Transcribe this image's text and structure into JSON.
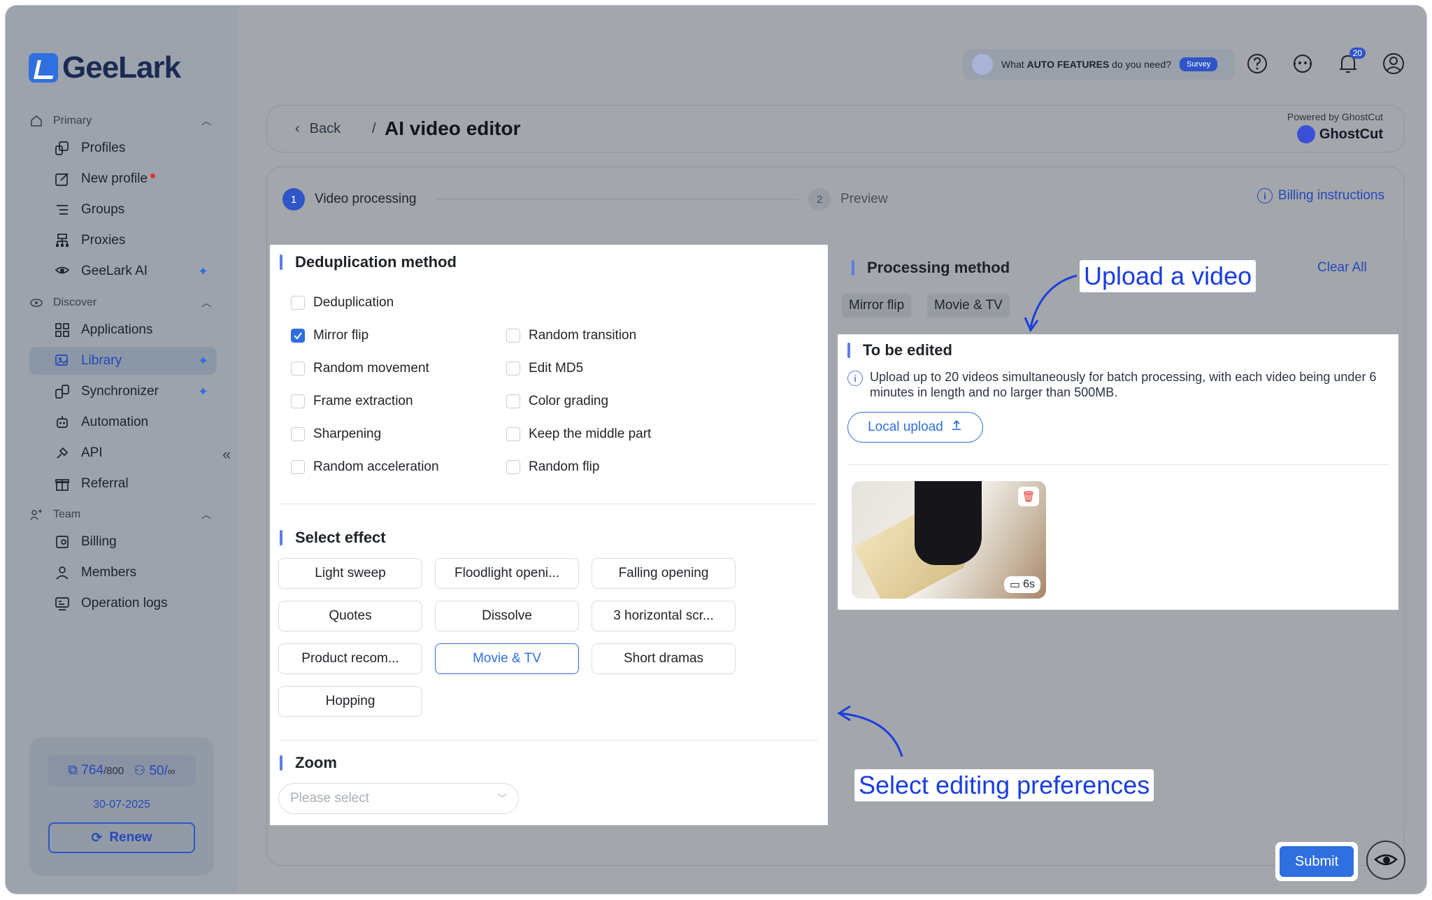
{
  "app": {
    "name": "GeeLark"
  },
  "sidebar": {
    "sections": [
      {
        "label": "Primary"
      },
      {
        "label": "Discover"
      },
      {
        "label": "Team"
      }
    ],
    "items": [
      {
        "label": "Profiles",
        "icon": "profiles-icon"
      },
      {
        "label": "New profile",
        "icon": "edit-icon"
      },
      {
        "label": "Groups",
        "icon": "list-icon"
      },
      {
        "label": "Proxies",
        "icon": "network-icon"
      },
      {
        "label": "GeeLark AI",
        "icon": "ai-eye-icon"
      },
      {
        "label": "Applications",
        "icon": "grid-icon"
      },
      {
        "label": "Library",
        "icon": "library-icon"
      },
      {
        "label": "Synchronizer",
        "icon": "sync-icon"
      },
      {
        "label": "Automation",
        "icon": "robot-icon"
      },
      {
        "label": "API",
        "icon": "api-icon"
      },
      {
        "label": "Referral",
        "icon": "gift-icon"
      },
      {
        "label": "Billing",
        "icon": "billing-icon"
      },
      {
        "label": "Members",
        "icon": "user-icon"
      },
      {
        "label": "Operation logs",
        "icon": "logs-icon"
      }
    ],
    "plan": {
      "profiles_used": "764",
      "profiles_total": "/800",
      "members_used": "50/",
      "members_total": "∞",
      "date": "30-07-2025",
      "renew_label": "Renew"
    }
  },
  "topbar": {
    "survey_prefix": "What ",
    "survey_bold": "AUTO FEATURES",
    "survey_suffix": " do you need?",
    "survey_button": "Survey",
    "notification_count": "20"
  },
  "header": {
    "back_label": "Back",
    "separator": "/",
    "title": "AI video editor",
    "powered_by": "Powered by GhostCut",
    "brand": "GhostCut"
  },
  "steps": [
    {
      "number": "1",
      "label": "Video processing"
    },
    {
      "number": "2",
      "label": "Preview"
    }
  ],
  "billing_instructions": "Billing instructions",
  "dedup": {
    "title": "Deduplication method",
    "options": [
      {
        "label": "Deduplication",
        "checked": false
      },
      {
        "label": "Mirror flip",
        "checked": true
      },
      {
        "label": "Random transition",
        "checked": false
      },
      {
        "label": "Random movement",
        "checked": false
      },
      {
        "label": "Edit MD5",
        "checked": false
      },
      {
        "label": "Frame extraction",
        "checked": false
      },
      {
        "label": "Color grading",
        "checked": false
      },
      {
        "label": "Sharpening",
        "checked": false
      },
      {
        "label": "Keep the middle part",
        "checked": false
      },
      {
        "label": "Random acceleration",
        "checked": false
      },
      {
        "label": "Random flip",
        "checked": false
      }
    ]
  },
  "effects": {
    "title": "Select effect",
    "items": [
      {
        "label": "Light sweep",
        "selected": false
      },
      {
        "label": "Floodlight openi...",
        "selected": false
      },
      {
        "label": "Falling opening",
        "selected": false
      },
      {
        "label": "Quotes",
        "selected": false
      },
      {
        "label": "Dissolve",
        "selected": false
      },
      {
        "label": "3 horizontal scr...",
        "selected": false
      },
      {
        "label": "Product recom...",
        "selected": false
      },
      {
        "label": "Movie & TV",
        "selected": true
      },
      {
        "label": "Short dramas",
        "selected": false
      },
      {
        "label": "Hopping",
        "selected": false
      }
    ]
  },
  "zoom": {
    "title": "Zoom",
    "placeholder": "Please select"
  },
  "processing": {
    "title": "Processing method",
    "clear_all": "Clear All",
    "tags": [
      "Mirror flip",
      "Movie & TV"
    ]
  },
  "upload": {
    "title": "To be edited",
    "info": "Upload up to 20 videos simultaneously for batch processing, with each video being under 6 minutes in length and no larger than 500MB.",
    "button": "Local upload",
    "video_duration": "6s"
  },
  "annotations": {
    "upload": "Upload a video",
    "preferences": "Select editing preferences"
  },
  "submit_label": "Submit",
  "colors": {
    "accent": "#2f6fe0",
    "annotation": "#1a3ee0",
    "danger": "#e5322d"
  }
}
